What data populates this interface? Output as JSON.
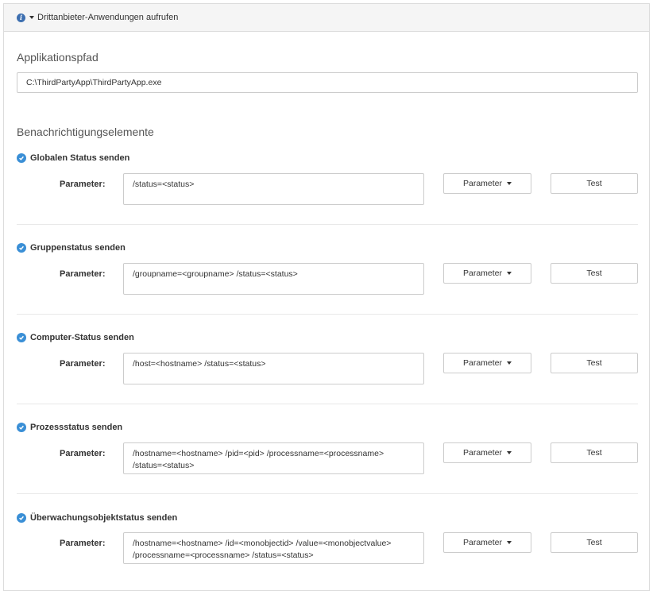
{
  "header": {
    "icon": "info-icon",
    "title": "Drittanbieter-Anwendungen aufrufen"
  },
  "application_path": {
    "title": "Applikationspfad",
    "value": "C:\\ThirdPartyApp\\ThirdPartyApp.exe"
  },
  "notifications": {
    "title": "Benachrichtigungselemente",
    "param_label": "Parameter:",
    "param_button_label": "Parameter",
    "test_button_label": "Test",
    "items": [
      {
        "label": "Globalen Status senden",
        "checked": true,
        "parameters": "/status=<status>"
      },
      {
        "label": "Gruppenstatus senden",
        "checked": true,
        "parameters": "/groupname=<groupname> /status=<status>"
      },
      {
        "label": "Computer-Status senden",
        "checked": true,
        "parameters": "/host=<hostname> /status=<status>"
      },
      {
        "label": "Prozessstatus senden",
        "checked": true,
        "parameters": "/hostname=<hostname> /pid=<pid> /processname=<processname>\n/status=<status>"
      },
      {
        "label": "Überwachungsobjektstatus senden",
        "checked": true,
        "parameters": "/hostname=<hostname> /id=<monobjectid> /value=<monobjectvalue>\n/processname=<processname> /status=<status>"
      }
    ]
  },
  "colors": {
    "accent": "#3a8fd6",
    "header_bg": "#f5f5f5",
    "border": "#cccccc"
  }
}
